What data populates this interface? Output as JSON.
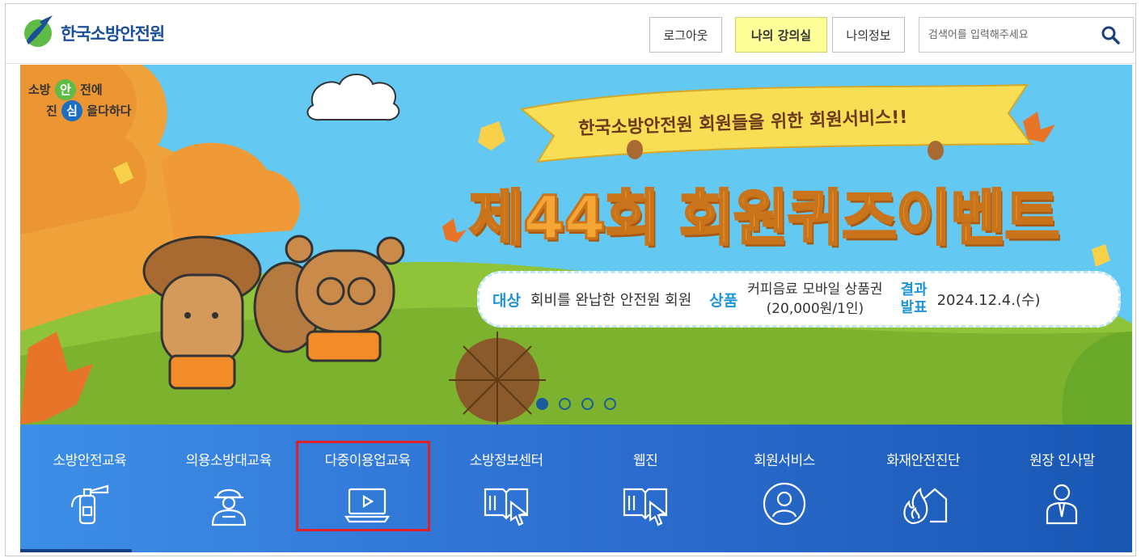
{
  "header": {
    "logo_text": "한국소방안전원",
    "logout_label": "로그아웃",
    "lecture_label": "나의 강의실",
    "myinfo_label": "나의정보",
    "search_placeholder": "검색어를 입력해주세요"
  },
  "banner": {
    "slogan_line1_a": "소방",
    "slogan_circle1": "안",
    "slogan_line1_b": "전에",
    "slogan_line2_a": "진",
    "slogan_circle2": "심",
    "slogan_line2_b": "을다하다",
    "ribbon": "한국소방안전원 회원들을 위한 회원서비스!!",
    "title": "제44회 회원퀴즈이벤트",
    "target_key": "대상",
    "target_value": "회비를 완납한 안전원 회원",
    "prize_key": "상품",
    "prize_line1": "커피음료 모바일 상품권",
    "prize_line2": "(20,000원/1인)",
    "result_key_line1": "결과",
    "result_key_line2": "발표",
    "result_date": "2024.12.4.(수)",
    "slides_total": 4,
    "slide_active": 1
  },
  "nav": {
    "items": [
      {
        "label": "소방안전교육",
        "icon": "fire-extinguisher-icon"
      },
      {
        "label": "의용소방대교육",
        "icon": "firefighter-icon"
      },
      {
        "label": "다중이용업교육",
        "icon": "laptop-play-icon"
      },
      {
        "label": "소방정보센터",
        "icon": "book-cursor-icon"
      },
      {
        "label": "웹진",
        "icon": "book-cursor-icon"
      },
      {
        "label": "회원서비스",
        "icon": "user-circle-icon"
      },
      {
        "label": "화재안전진단",
        "icon": "house-fire-icon"
      },
      {
        "label": "원장 인사말",
        "icon": "person-tie-icon"
      }
    ],
    "highlighted_index": 2,
    "highlight_color": "#e0202a"
  },
  "colors": {
    "brand": "#1b4f97",
    "nav_start": "#3d8fe6",
    "nav_end": "#1957b3",
    "lecture_bg": "#ffff99",
    "banner_sky": "#63c8f2"
  }
}
